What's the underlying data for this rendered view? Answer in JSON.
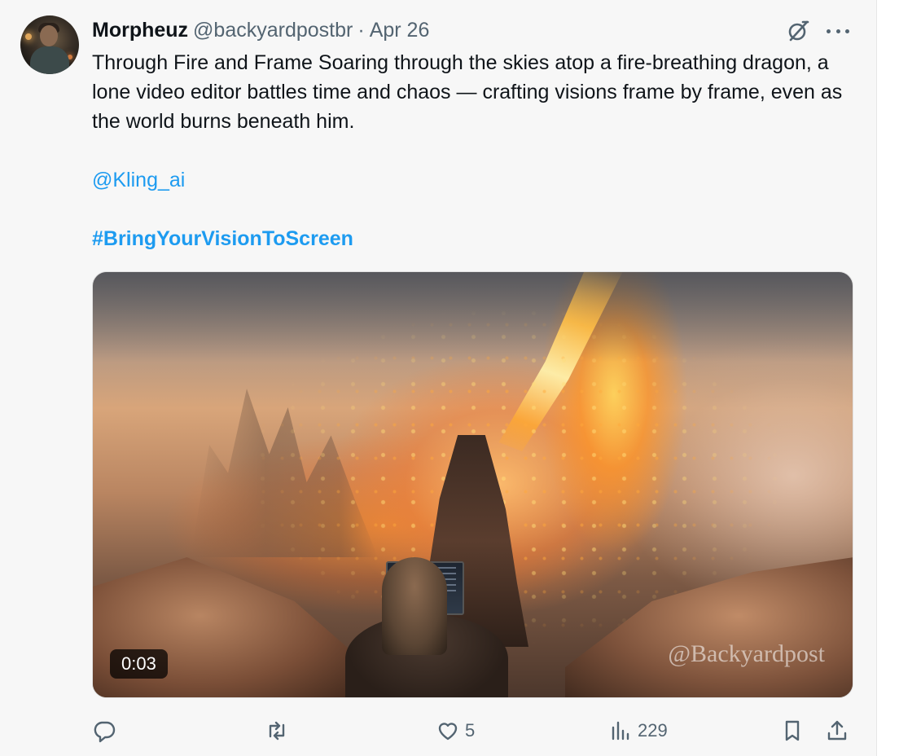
{
  "author": {
    "name": "Morpheuz",
    "handle": "@backyardpostbr",
    "separator": "·",
    "date": "Apr 26"
  },
  "tweet": {
    "text": "Through Fire and Frame  Soaring through the skies atop a fire-breathing dragon, a lone video editor battles time and chaos — crafting visions frame by frame, even as the world burns beneath him.",
    "mention": "@Kling_ai",
    "hashtag": "#BringYourVisionToScreen"
  },
  "media": {
    "duration": "0:03",
    "watermark": "@Backyardpost"
  },
  "actions": {
    "reply_count": "",
    "retweet_count": "",
    "like_count": "5",
    "view_count": "229"
  },
  "icons": {
    "grok": "grok-icon",
    "more": "more-icon",
    "reply": "reply-icon",
    "retweet": "retweet-icon",
    "like": "heart-icon",
    "views": "views-icon",
    "bookmark": "bookmark-icon",
    "share": "share-icon"
  },
  "colors": {
    "accent": "#1d9bf0",
    "secondary_text": "#536471",
    "primary_text": "#0f1419"
  }
}
